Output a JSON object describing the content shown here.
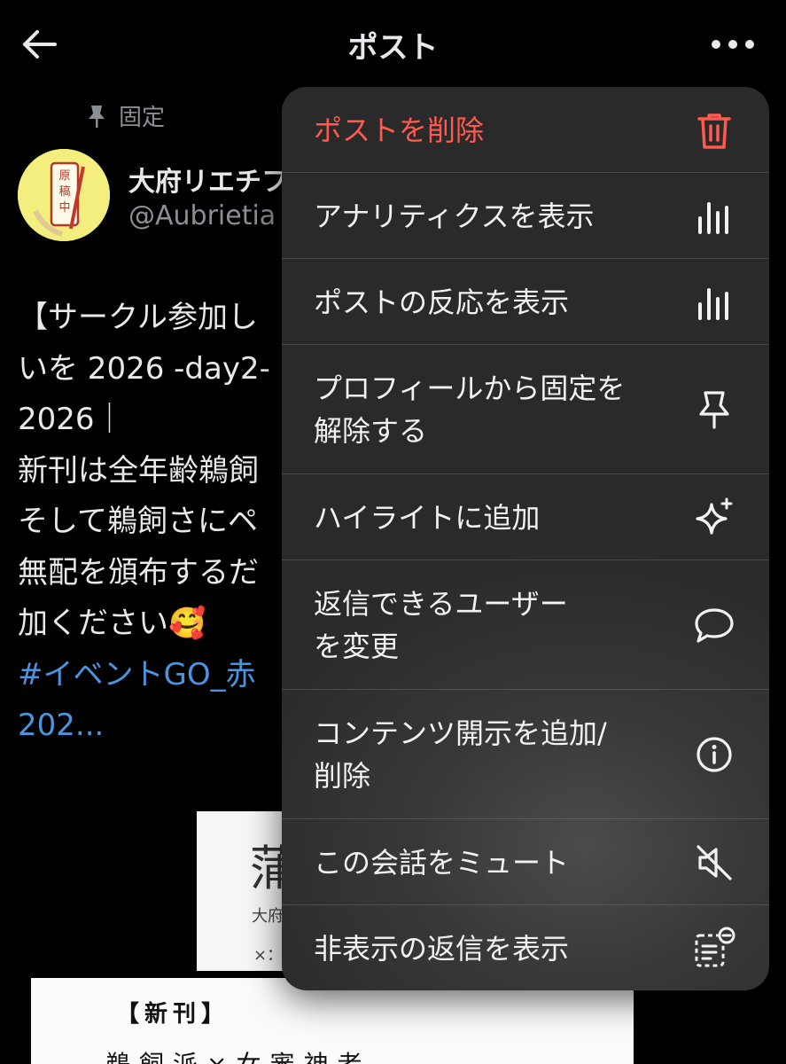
{
  "header": {
    "title": "ポスト",
    "back_icon": "arrow-left-icon",
    "more_icon": "more-horizontal-icon"
  },
  "pinned": {
    "label": "固定",
    "icon": "pin-icon"
  },
  "author": {
    "avatar_text": "原稿中。",
    "name": "大府リエチフ",
    "handle": "@Aubrietia"
  },
  "post": {
    "lines": [
      "【サークル参加し",
      "いを 2026 -day2-",
      "2026｜",
      "新刊は全年齢鵜飼",
      "そして鵜飼さにペ",
      "無配を頒布するだ",
      "加ください🥰"
    ],
    "hashtag_lines": [
      "#イベントGO_赤",
      "202..."
    ]
  },
  "images": {
    "img1_big": "蒲",
    "img1_small1": "大府",
    "img1_small2": "×：",
    "img2_line1": "【新刊】",
    "img2_line2": "鵜飼派×女審神者"
  },
  "menu": {
    "items": [
      {
        "label": "ポストを削除",
        "icon": "trash-icon",
        "danger": true
      },
      {
        "label": "アナリティクスを表示",
        "icon": "analytics-bars-icon"
      },
      {
        "label": "ポストの反応を表示",
        "icon": "engagement-bars-icon"
      },
      {
        "label": "プロフィールから固定を",
        "label2": "解除する",
        "icon": "pin-icon"
      },
      {
        "label": "ハイライトに追加",
        "icon": "sparkle-icon"
      },
      {
        "label": "返信できるユーザー",
        "label2": "を変更",
        "icon": "speech-bubble-icon"
      },
      {
        "label": "コンテンツ開示を追加/",
        "label2": "削除",
        "icon": "info-circle-icon"
      },
      {
        "label": "この会話をミュート",
        "icon": "mute-icon"
      },
      {
        "label": "非表示の返信を表示",
        "icon": "hidden-replies-icon"
      }
    ]
  },
  "colors": {
    "background": "#000000",
    "menu_background": "#2e2e2e",
    "danger": "#ff5a4f",
    "hashtag": "#4b95e0",
    "secondary_text": "#8b8f94"
  }
}
